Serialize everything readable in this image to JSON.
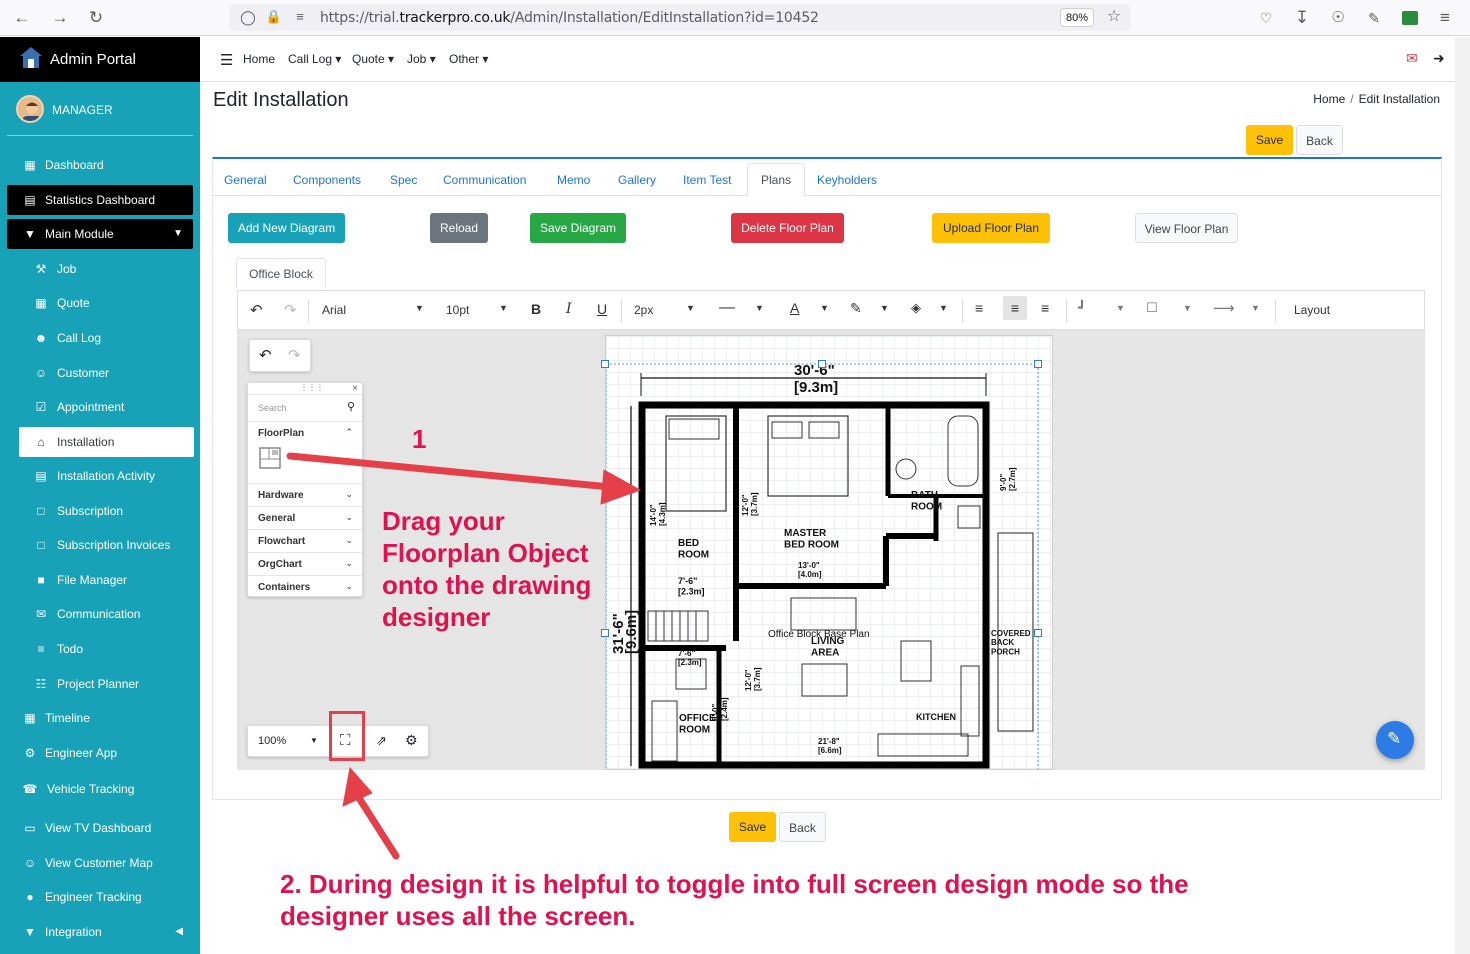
{
  "browser": {
    "url_prefix": "https://trial.",
    "url_domain": "trackerpro.co.uk",
    "url_path": "/Admin/Installation/EditInstallation?id=10452",
    "zoom": "80%"
  },
  "sidebar": {
    "brand": "Admin Portal",
    "user": "MANAGER",
    "items": [
      {
        "label": "Dashboard",
        "icon": "dashboard-icon"
      },
      {
        "label": "Statistics Dashboard",
        "icon": "chart-icon"
      },
      {
        "label": "Main Module",
        "icon": "pin-icon"
      },
      {
        "label": "Job",
        "icon": "wrench-icon"
      },
      {
        "label": "Quote",
        "icon": "calculator-icon"
      },
      {
        "label": "Call Log",
        "icon": "user-phone-icon"
      },
      {
        "label": "Customer",
        "icon": "users-icon"
      },
      {
        "label": "Appointment",
        "icon": "calendar-check-icon"
      },
      {
        "label": "Installation",
        "icon": "home-icon"
      },
      {
        "label": "Installation Activity",
        "icon": "chart-icon"
      },
      {
        "label": "Subscription",
        "icon": "file-icon"
      },
      {
        "label": "Subscription Invoices",
        "icon": "file-icon"
      },
      {
        "label": "File Manager",
        "icon": "folder-icon"
      },
      {
        "label": "Communication",
        "icon": "envelope-icon"
      },
      {
        "label": "Todo",
        "icon": "list-icon"
      },
      {
        "label": "Project Planner",
        "icon": "sitemap-icon"
      },
      {
        "label": "Timeline",
        "icon": "calendar-icon"
      },
      {
        "label": "Engineer App",
        "icon": "user-gear-icon"
      },
      {
        "label": "Vehicle Tracking",
        "icon": "headset-icon"
      },
      {
        "label": "View TV Dashboard",
        "icon": "monitor-icon"
      },
      {
        "label": "View Customer Map",
        "icon": "map-users-icon"
      },
      {
        "label": "Engineer Tracking",
        "icon": "map-marker-icon"
      },
      {
        "label": "Integration",
        "icon": "pin-icon"
      }
    ]
  },
  "topnav": {
    "home": "Home",
    "call_log": "Call Log",
    "quote": "Quote",
    "job": "Job",
    "other": "Other"
  },
  "page": {
    "title": "Edit Installation",
    "breadcrumb_home": "Home",
    "breadcrumb_sep": "/",
    "breadcrumb_current": "Edit Installation",
    "save": "Save",
    "back": "Back"
  },
  "tabs": [
    "General",
    "Components",
    "Spec",
    "Communication",
    "Memo",
    "Gallery",
    "Item Test",
    "Plans",
    "Keyholders"
  ],
  "actions": {
    "add": "Add New Diagram",
    "reload": "Reload",
    "save_diagram": "Save Diagram",
    "delete": "Delete Floor Plan",
    "upload": "Upload Floor Plan",
    "view": "View Floor Plan"
  },
  "plan_tab": "Office Block",
  "toolbar": {
    "font": "Arial",
    "size": "10pt",
    "bold": "B",
    "italic": "I",
    "underline": "U",
    "stroke": "2px",
    "layout": "Layout"
  },
  "shapes": {
    "search_placeholder": "Search",
    "groups": [
      "FloorPlan",
      "Hardware",
      "General",
      "Flowchart",
      "OrgChart",
      "Containers"
    ]
  },
  "zoom": "100%",
  "floorplan": {
    "caption": "Office Block Base Plan",
    "width_label": "30'-6\"",
    "width_metric": "[9.3m]",
    "height_label": "31'-6\"",
    "height_metric": "[9.6m]",
    "rooms": {
      "bed": "BED\nROOM",
      "bed_dim": "7'-6\"\n[2.3m]",
      "bed_side": "14'-0\"\n[4.3m]",
      "master": "MASTER\nBED ROOM",
      "master_dim": "13'-0\"\n[4.0m]",
      "master_side": "12'-0\"\n[3.7m]",
      "bath": "BATH\nROOM",
      "bath_side": "9'-0\"\n[2.7m]",
      "living": "LIVING\nAREA",
      "living_side": "12'-0\"\n[3.7m]",
      "office": "OFFICE\nROOM",
      "office_dim": "7'-6\"\n[2.3m]",
      "office_side": "8'-0\"\n[2.4m]",
      "kitchen": "KITCHEN",
      "kitchen_dim": "21'-8\"\n[6.6m]",
      "porch": "COVERED\nBACK\nPORCH"
    }
  },
  "annotations": {
    "step1": "1",
    "drag": "Drag your Floorplan Object onto the drawing designer",
    "step2": "2. During design it is helpful to toggle into full screen design mode so the designer uses all the screen."
  },
  "colors": {
    "accent": "#17a2b8",
    "annotation": "#e0114e",
    "link": "#1e73d8"
  }
}
